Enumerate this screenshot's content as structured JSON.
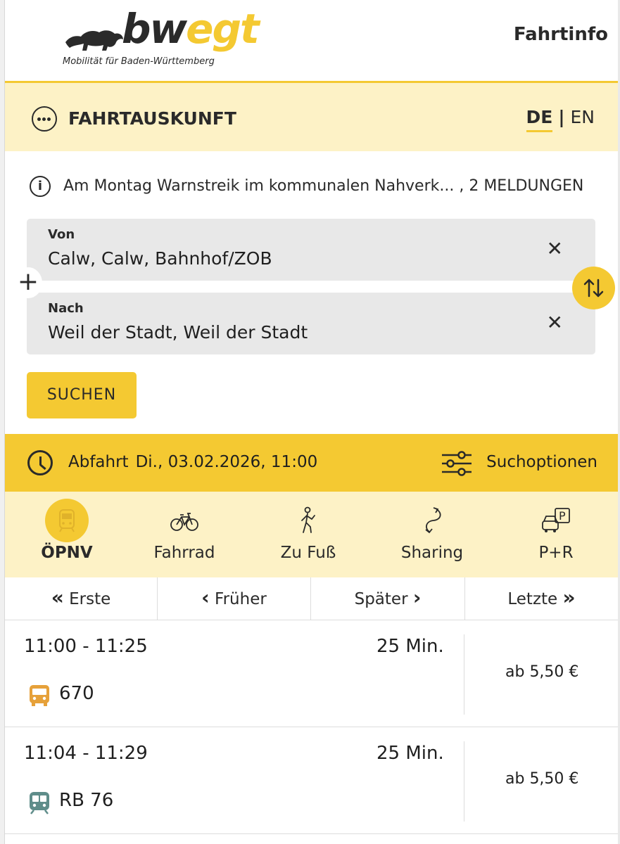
{
  "header": {
    "logo_word_a": "bw",
    "logo_word_b": "egt",
    "logo_tagline": "Mobilität für Baden-Württemberg",
    "title": "Fahrtinfo"
  },
  "fahrtauskunft": {
    "label": "FAHRTAUSKUNFT",
    "lang_de": "DE",
    "lang_sep": "|",
    "lang_en": "EN"
  },
  "info": {
    "text": "Am Montag Warnstreik im kommunalen Nahverk... , 2 MELDUNGEN"
  },
  "from": {
    "label": "Von",
    "value": "Calw, Calw, Bahnhof/ZOB",
    "clear": "✕"
  },
  "to": {
    "label": "Nach",
    "value": "Weil der Stadt, Weil der Stadt",
    "clear": "✕"
  },
  "add_via": "+",
  "search_button": "SUCHEN",
  "departure": {
    "label": "Abfahrt",
    "value": "Di., 03.02.2026, 11:00",
    "options_label": "Suchoptionen"
  },
  "modes": [
    {
      "label": "ÖPNV",
      "icon": "train-icon",
      "active": true
    },
    {
      "label": "Fahrrad",
      "icon": "bicycle-icon",
      "active": false
    },
    {
      "label": "Zu Fuß",
      "icon": "walking-icon",
      "active": false
    },
    {
      "label": "Sharing",
      "icon": "sharing-icon",
      "active": false
    },
    {
      "label": "P+R",
      "icon": "park-ride-icon",
      "active": false
    }
  ],
  "pager": {
    "first": "Erste",
    "earlier": "Früher",
    "later": "Später",
    "last": "Letzte"
  },
  "results": [
    {
      "time": "11:00  -  11:25",
      "duration": "25 Min.",
      "line": "670",
      "vehicle": "bus-icon",
      "price": "ab 5,50 €"
    },
    {
      "time": "11:04  -  11:29",
      "duration": "25 Min.",
      "line": "RB 76",
      "vehicle": "regional-train-icon",
      "price": "ab 5,50 €"
    }
  ],
  "colors": {
    "brand_yellow": "#f4c932",
    "light_yellow": "#fdf2c6",
    "bus_orange": "#e6a13a",
    "train_teal": "#5f8d8a",
    "text_dark": "#2a2a2a"
  }
}
